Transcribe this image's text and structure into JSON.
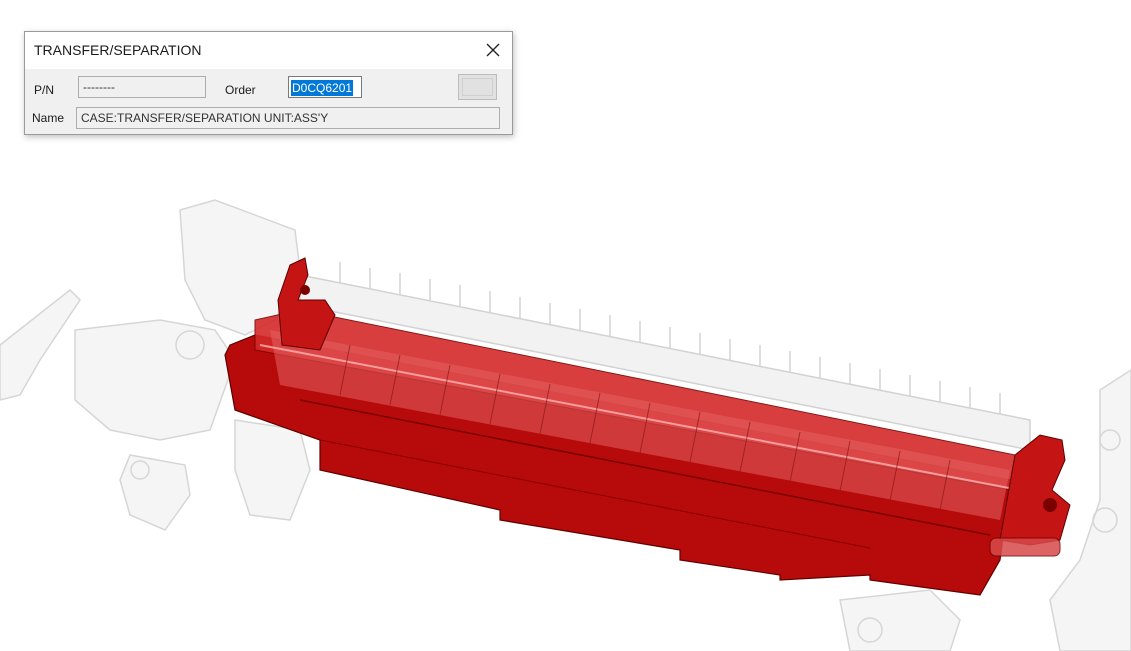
{
  "dialog": {
    "title": "TRANSFER/SEPARATION",
    "pn_label": "P/N",
    "pn_value": "--------",
    "order_label": "Order",
    "order_value": "D0CQ6201",
    "name_label": "Name",
    "name_value": "CASE:TRANSFER/SEPARATION UNIT:ASS'Y",
    "close_icon": "close-icon"
  },
  "viewport": {
    "highlight_color": "#c40d0d",
    "ghost_color": "#c8c8c8"
  }
}
